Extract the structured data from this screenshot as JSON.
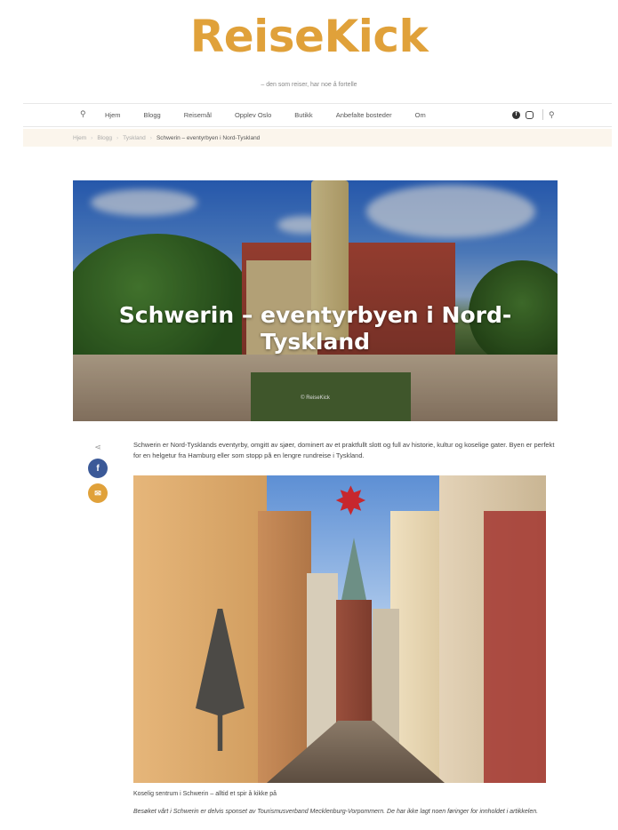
{
  "site": {
    "logo": "ReiseKick",
    "tagline": "– den som reiser, har noe å fortelle"
  },
  "nav": {
    "items": [
      "Hjem",
      "Blogg",
      "Reisemål",
      "Opplev Oslo",
      "Butikk",
      "Anbefalte bosteder",
      "Om"
    ],
    "icons": [
      "search-icon",
      "facebook-icon",
      "instagram-icon",
      "search-icon"
    ]
  },
  "breadcrumb": {
    "items": [
      "Hjem",
      "Blogg",
      "Tyskland"
    ],
    "current": "Schwerin – eventyrbyen i Nord-Tyskland"
  },
  "hero": {
    "title": "Schwerin – eventyrbyen i Nord-Tyskland",
    "credit": "© ReiseKick"
  },
  "share": {
    "icons": [
      "share-icon",
      "facebook-icon",
      "email-icon"
    ],
    "facebook_glyph": "f",
    "mail_glyph": "✉"
  },
  "article": {
    "intro": "Schwerin er Nord-Tysklands eventyrby, omgitt av sjøer, dominert av et praktfullt slott og full av historie, kultur og koselige gater. Byen er perfekt for en helgetur fra Hamburg eller som stopp på en lengre rundreise i Tyskland.",
    "caption": "Koselig sentrum i Schwerin – alltid et spir å kikke på",
    "disclaimer": "Besøket vårt i Schwerin er delvis sponset av Tourismusverband Mecklenburg-Vorpommern. De har ikke lagt noen føringer for innholdet i artikkelen."
  },
  "colors": {
    "brand": "#e0a13a",
    "facebook": "#3b5998",
    "breadcrumb_bg": "#fbf5ec"
  }
}
